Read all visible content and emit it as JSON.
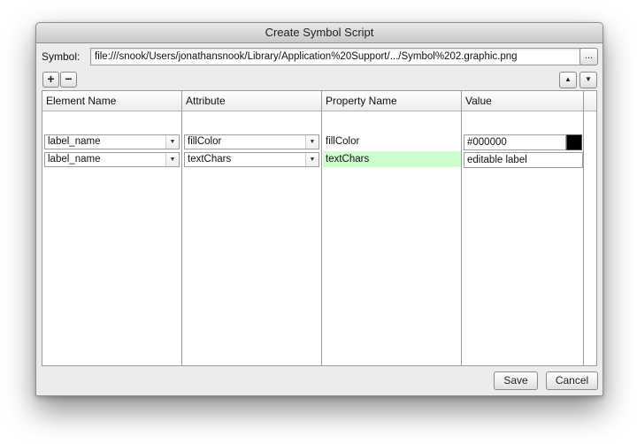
{
  "window": {
    "title": "Create Symbol Script"
  },
  "symbol": {
    "label": "Symbol:",
    "path": "file:///snook/Users/jonathansnook/Library/Application%20Support/.../Symbol%202.graphic.png",
    "browse_label": "..."
  },
  "toolbar": {
    "add_label": "+",
    "remove_label": "−",
    "move_up_icon": "triangle-up-icon",
    "move_down_icon": "triangle-down-icon"
  },
  "table": {
    "headers": {
      "element_name": "Element Name",
      "attribute": "Attribute",
      "property_name": "Property Name",
      "value": "Value"
    },
    "rows": [
      {
        "element_name": "label_name",
        "attribute": "fillColor",
        "property_name": "fillColor",
        "value": "#000000",
        "swatch_color": "#000000"
      },
      {
        "element_name": "label_name",
        "attribute": "textChars",
        "property_name": "textChars",
        "value": "editable label",
        "highlight": "#ccffcc"
      }
    ]
  },
  "footer": {
    "save_label": "Save",
    "cancel_label": "Cancel"
  }
}
